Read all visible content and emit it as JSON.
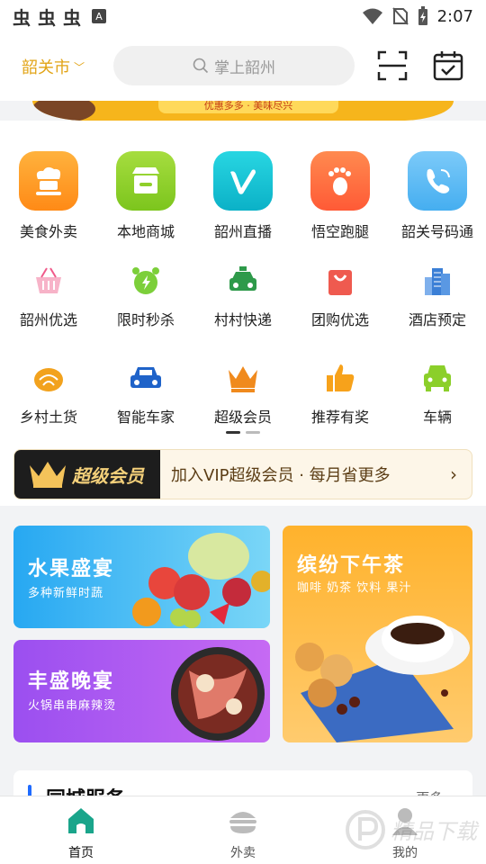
{
  "status_bar": {
    "left_glyphs": [
      "虫",
      "虫",
      "虫"
    ],
    "a_badge": "A",
    "time": "2:07"
  },
  "header": {
    "city": "韶关市",
    "search_placeholder": "掌上韶州"
  },
  "banner": {
    "partial_text": "优惠多多 · 美味尽兴"
  },
  "menu_rows": [
    [
      {
        "label": "美食外卖",
        "icon": "chef-hat-icon",
        "color": "#ff9a22"
      },
      {
        "label": "本地商城",
        "icon": "store-icon",
        "color": "#8fcf2a"
      },
      {
        "label": "韶州直播",
        "icon": "live-v-icon",
        "color": "#14c6d6"
      },
      {
        "label": "悟空跑腿",
        "icon": "footprint-icon",
        "color": "#ff6a3d"
      },
      {
        "label": "韶关号码通",
        "icon": "phone-icon",
        "color": "#59b8f5"
      }
    ],
    [
      {
        "label": "韶州优选",
        "icon": "basket-icon",
        "color": "#f05a8a"
      },
      {
        "label": "限时秒杀",
        "icon": "alarm-clock-icon",
        "color": "#7ccf3a"
      },
      {
        "label": "村村快递",
        "icon": "taxi-icon",
        "color": "#2e9a4a"
      },
      {
        "label": "团购优选",
        "icon": "shopping-bag-icon",
        "color": "#ef5a4f"
      },
      {
        "label": "酒店预定",
        "icon": "hotel-building-icon",
        "color": "#3b7fd6"
      }
    ],
    [
      {
        "label": "乡村土货",
        "icon": "harvest-icon",
        "color": "#f2a21d"
      },
      {
        "label": "智能车家",
        "icon": "car-icon",
        "color": "#1f63c9"
      },
      {
        "label": "超级会员",
        "icon": "crown-icon",
        "color": "#f08a1d"
      },
      {
        "label": "推荐有奖",
        "icon": "thumbs-up-icon",
        "color": "#f7a21b"
      },
      {
        "label": "车辆",
        "icon": "vehicle-icon",
        "color": "#8bcf2a"
      }
    ]
  ],
  "vip": {
    "badge": "超级会员",
    "text": "加入VIP超级会员 · 每月省更多",
    "arrow": "›"
  },
  "promos": [
    {
      "title": "水果盛宴",
      "subtitle": "多种新鲜时蔬"
    },
    {
      "title": "丰盛晚宴",
      "subtitle": "火锅串串麻辣烫"
    },
    {
      "title": "缤纷下午茶",
      "subtitle": "咖啡 奶茶 饮料 果汁"
    }
  ],
  "service": {
    "title": "同城服务",
    "more": "更多 ›"
  },
  "bottom_nav": {
    "home": "首页",
    "takeout": "外卖",
    "mine": "我的"
  },
  "watermark_text": "精品下载",
  "colors": {
    "accent_gold": "#e2a417",
    "nav_active": "#1aa58b"
  }
}
